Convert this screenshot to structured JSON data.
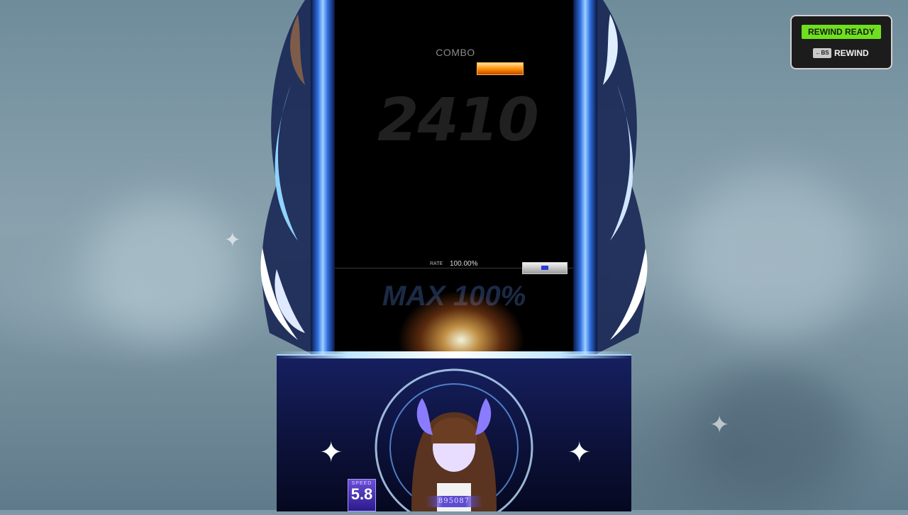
{
  "game": {
    "combo_label": "COMBO",
    "combo_count": "2410",
    "rate_label": "RATE",
    "rate_value": "100.00%",
    "max_text": "MAX 100%",
    "speed_label": "SPEED",
    "speed_value": "5.8",
    "score": "895087"
  },
  "rewind": {
    "ready_label": "REWIND READY",
    "key_label": "←BS",
    "action_label": "REWIND"
  },
  "colors": {
    "rewind_ready_bg": "#6ee11e",
    "judge_bar": "#ff8a00",
    "lane_bg": "#000000"
  }
}
